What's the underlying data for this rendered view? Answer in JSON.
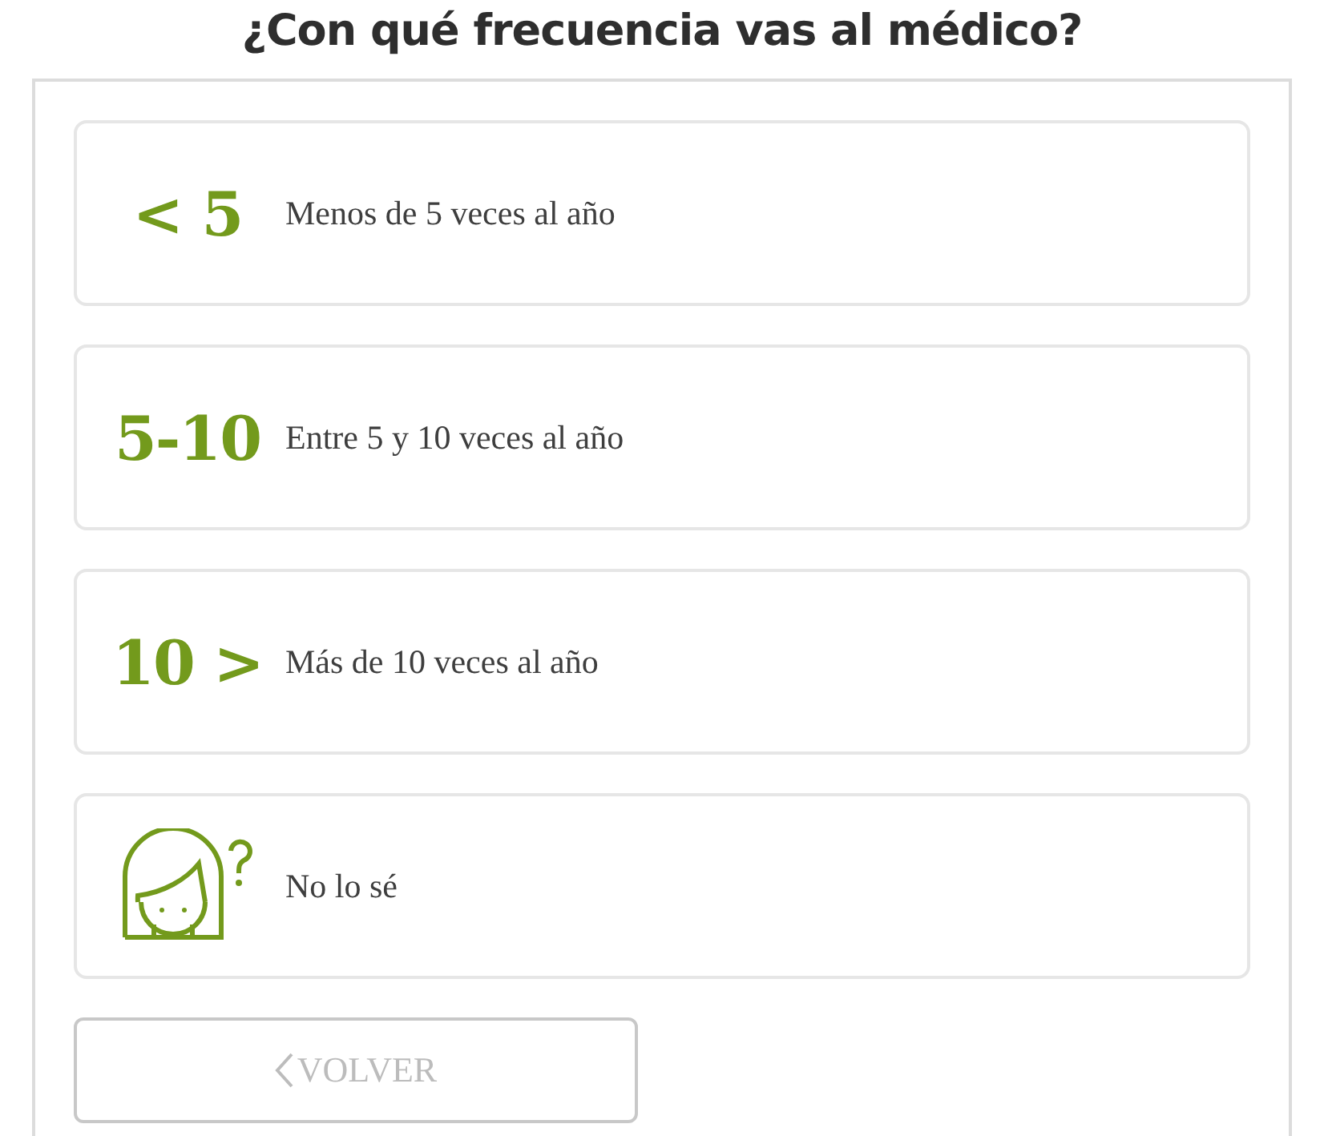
{
  "title": "¿Con qué frecuencia vas al médico?",
  "options": [
    {
      "kind": "text",
      "badge": "< 5",
      "label": "Menos de 5 veces al año"
    },
    {
      "kind": "text",
      "badge": "5-10",
      "label": "Entre 5 y 10 veces al año"
    },
    {
      "kind": "text",
      "badge": "10 >",
      "label": "Más de 10 veces al año"
    },
    {
      "kind": "icon",
      "label": "No lo sé"
    }
  ],
  "back_button": {
    "label": "VOLVER",
    "disabled": true
  }
}
